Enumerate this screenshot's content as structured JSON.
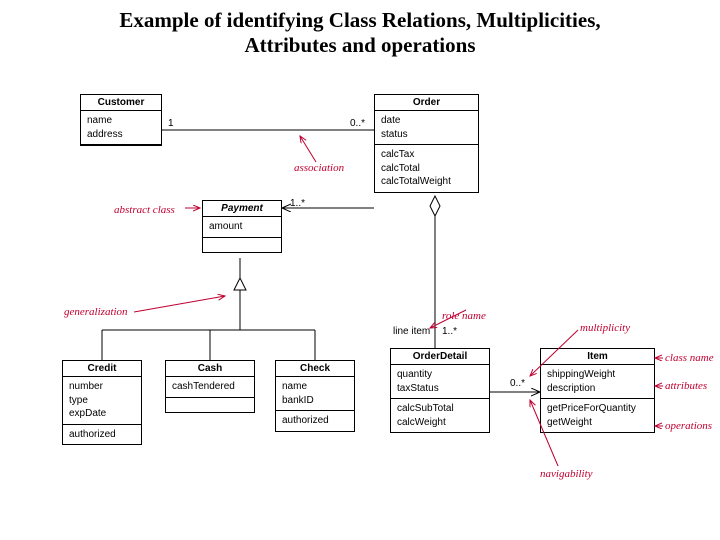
{
  "title_line1": "Example of identifying Class Relations, Multiplicities,",
  "title_line2": "Attributes and operations",
  "classes": {
    "customer": {
      "name": "Customer",
      "attrs": [
        "name",
        "address"
      ],
      "ops": []
    },
    "order": {
      "name": "Order",
      "attrs": [
        "date",
        "status"
      ],
      "ops": [
        "calcTax",
        "calcTotal",
        "calcTotalWeight"
      ]
    },
    "payment": {
      "name": "Payment",
      "attrs": [
        "amount"
      ],
      "ops": []
    },
    "credit": {
      "name": "Credit",
      "attrs": [
        "number",
        "type",
        "expDate"
      ],
      "ops": [
        "authorized"
      ]
    },
    "cash": {
      "name": "Cash",
      "attrs": [
        "cashTendered"
      ],
      "ops": []
    },
    "check": {
      "name": "Check",
      "attrs": [
        "name",
        "bankID"
      ],
      "ops": [
        "authorized"
      ]
    },
    "orderdetail": {
      "name": "OrderDetail",
      "attrs": [
        "quantity",
        "taxStatus"
      ],
      "ops": [
        "calcSubTotal",
        "calcWeight"
      ]
    },
    "item": {
      "name": "Item",
      "attrs": [
        "shippingWeight",
        "description"
      ],
      "ops": [
        "getPriceForQuantity",
        "getWeight"
      ]
    }
  },
  "multiplicities": {
    "cust_order_left": "1",
    "cust_order_right": "0..*",
    "order_payment": "1..*",
    "order_detail": "1..*",
    "detail_item": "0..*"
  },
  "role_names": {
    "line_item": "line item"
  },
  "annotations": {
    "abstract_class": "abstract class",
    "association": "association",
    "generalization": "generalization",
    "role_name": "role name",
    "multiplicity": "multiplicity",
    "class_name": "class name",
    "attributes": "attributes",
    "operations": "operations",
    "navigability": "navigability"
  }
}
